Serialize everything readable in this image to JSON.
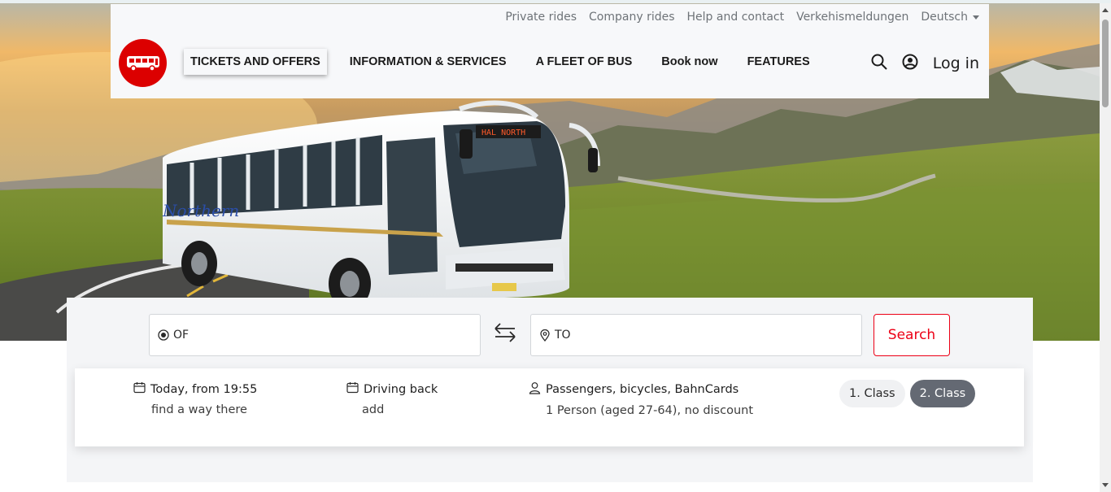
{
  "colors": {
    "brand_red": "#dc0000",
    "search_red": "#ec0016",
    "active_class_bg": "#646973"
  },
  "meta_nav": {
    "items": [
      "Private rides",
      "Company rides",
      "Help and contact",
      "Verkehismeldungen"
    ],
    "language": "Deutsch"
  },
  "main_nav": {
    "items": [
      "TICKETS AND OFFERS",
      "INFORMATION & SERVICES",
      "A FLEET OF BUS",
      "Book now",
      "FEATURES"
    ]
  },
  "tools": {
    "login_label": "Log in",
    "search_icon": "search-icon",
    "account_icon": "user-circle-icon"
  },
  "hero": {
    "bus_sign": "HAL NORTH",
    "bus_brand": "Northern"
  },
  "search": {
    "from_placeholder": "OF",
    "to_placeholder": "TO",
    "button_label": "Search"
  },
  "options": {
    "outbound_title": "Today, from 19:55",
    "outbound_sub": "find a way there",
    "return_title": "Driving back",
    "return_sub": "add",
    "passengers_title": "Passengers, bicycles, BahnCards",
    "passengers_sub": "1 Person (aged 27-64), no discount",
    "class_1": "1. Class",
    "class_2": "2. Class",
    "selected_class": "2. Class"
  }
}
